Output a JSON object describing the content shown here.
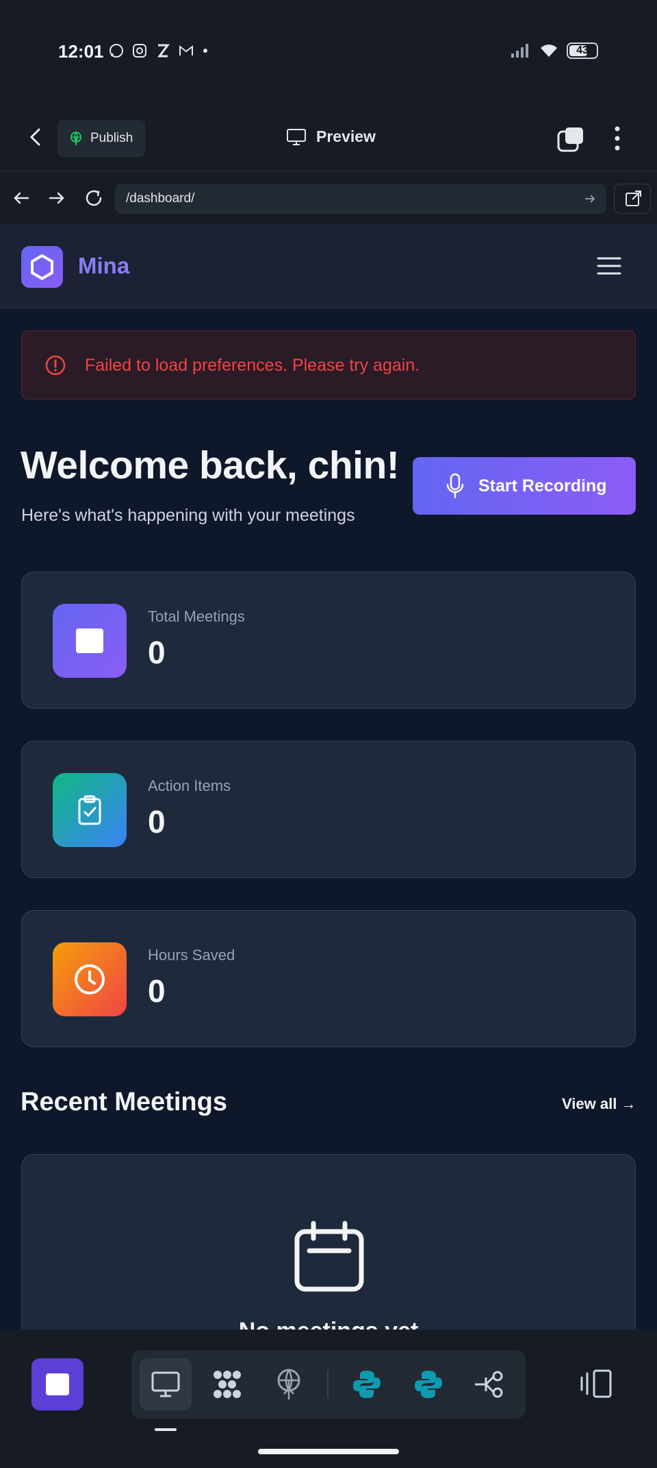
{
  "status_bar": {
    "time": "12:01",
    "battery": "43"
  },
  "toolbar": {
    "publish_label": "Publish",
    "preview_label": "Preview"
  },
  "browser": {
    "url": "/dashboard/"
  },
  "site": {
    "brand": "Mina"
  },
  "alert": {
    "message": "Failed to load preferences. Please try again."
  },
  "hero": {
    "title": "Welcome back, chin!",
    "subtitle": "Here's what's happening with your meetings",
    "record_button": "Start Recording"
  },
  "stats": [
    {
      "label": "Total Meetings",
      "value": "0",
      "icon": "square-icon",
      "color_from": "#6366f1",
      "color_to": "#8b5cf6"
    },
    {
      "label": "Action Items",
      "value": "0",
      "icon": "clipboard-check-icon",
      "color_from": "#10b981",
      "color_to": "#3b82f6"
    },
    {
      "label": "Hours Saved",
      "value": "0",
      "icon": "clock-icon",
      "color_from": "#f59e0b",
      "color_to": "#ef4444"
    }
  ],
  "recent": {
    "title": "Recent Meetings",
    "view_all": "View all →",
    "empty_text": "No meetings yet"
  },
  "dock": {
    "items": [
      "desktop-icon",
      "network-icon",
      "deploy-icon",
      "python-icon",
      "python-icon",
      "git-branch-icon"
    ]
  },
  "colors": {
    "accent": "#6366f1",
    "error": "#ef4444",
    "background": "#0f172a",
    "card": "#1e293b"
  }
}
